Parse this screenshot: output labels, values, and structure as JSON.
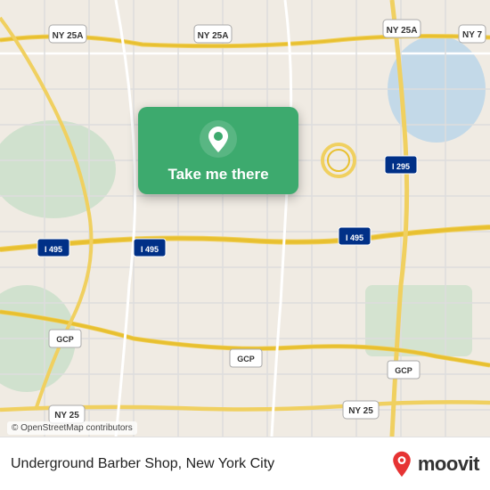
{
  "map": {
    "attribution": "© OpenStreetMap contributors"
  },
  "card": {
    "button_label": "Take me there",
    "icon_name": "location-pin-icon"
  },
  "footer": {
    "place_name": "Underground Barber Shop, New York City",
    "moovit_label": "moovit"
  }
}
